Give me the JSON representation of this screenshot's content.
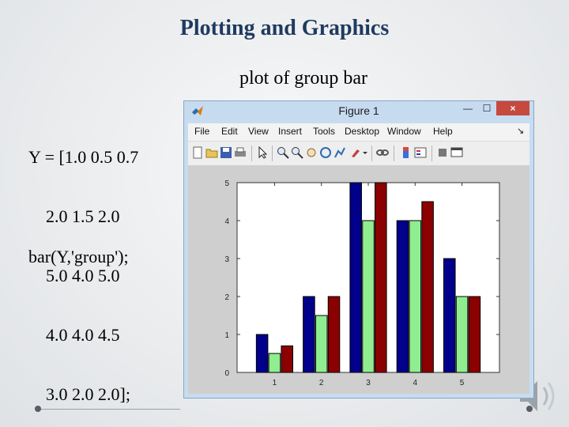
{
  "slide": {
    "title": "Plotting and Graphics",
    "subtitle": "plot of group bar",
    "code_lines": [
      "Y = [1.0 0.5 0.7",
      "    2.0 1.5 2.0",
      "    5.0 4.0 5.0",
      "    4.0 4.0 4.5",
      "    3.0 2.0 2.0];"
    ],
    "code_call": "bar(Y,'group');"
  },
  "window": {
    "title": "Figure 1",
    "minimize_glyph": "—",
    "maximize_glyph": "☐",
    "close_glyph": "×",
    "menu": [
      "File",
      "Edit",
      "View",
      "Insert",
      "Tools",
      "Desktop",
      "Window",
      "Help"
    ],
    "dock_glyph": "↘",
    "toolbar_icons": [
      "new-figure-icon",
      "open-file-icon",
      "save-icon",
      "print-icon",
      "pointer-icon",
      "zoom-in-icon",
      "zoom-out-icon",
      "rotate-icon",
      "pan-icon",
      "data-cursor-icon",
      "brush-icon",
      "link-plot-icon",
      "colorbar-icon",
      "legend-icon",
      "hide-plot-tools-icon",
      "show-plot-tools-icon"
    ],
    "colors": {
      "series1": "#00008b",
      "series2": "#90ee90",
      "series3": "#8b0000"
    }
  },
  "chart_data": {
    "type": "bar",
    "categories": [
      "1",
      "2",
      "3",
      "4",
      "5"
    ],
    "series": [
      {
        "values": [
          1.0,
          2.0,
          5.0,
          4.0,
          3.0
        ]
      },
      {
        "values": [
          0.5,
          1.5,
          4.0,
          4.0,
          2.0
        ]
      },
      {
        "values": [
          0.7,
          2.0,
          5.0,
          4.5,
          2.0
        ]
      }
    ],
    "yticks": [
      "0",
      "1",
      "2",
      "3",
      "4",
      "5"
    ],
    "ylim": [
      0,
      5
    ],
    "grid": false
  }
}
